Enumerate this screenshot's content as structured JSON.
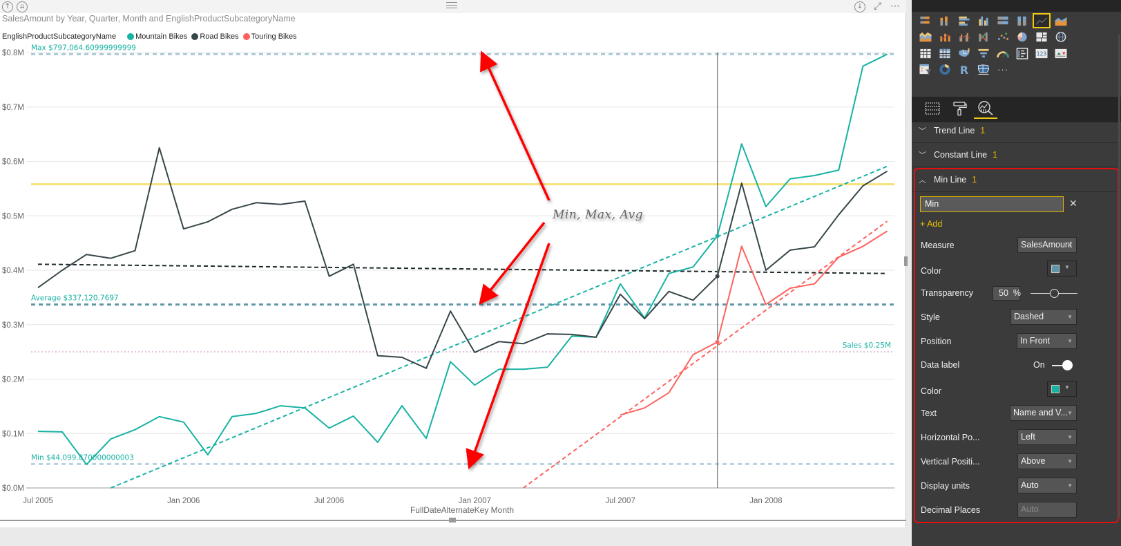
{
  "report": {
    "drill_up_icon": "arrow-up-circle-icon",
    "drill_down_icon": "double-arrow-down-circle-icon",
    "drill_mode_icon": "arrow-down-circle-icon",
    "focus_icon": "focus-mode-icon",
    "more_icon": "ellipsis-icon",
    "annotation_text": "Min, Max, Avg"
  },
  "chart_data": {
    "type": "line",
    "title": "SalesAmount by Year, Quarter, Month and EnglishProductSubcategoryName",
    "legend_title": "EnglishProductSubcategoryName",
    "legend_position": "top-left",
    "xlabel": "FullDateAlternateKey Month",
    "ylabel": "",
    "ylim": [
      0,
      0.8
    ],
    "y_unit": "$M",
    "yticks": [
      "$0.0M",
      "$0.1M",
      "$0.2M",
      "$0.3M",
      "$0.4M",
      "$0.5M",
      "$0.6M",
      "$0.7M",
      "$0.8M"
    ],
    "ytick_values": [
      0,
      0.1,
      0.2,
      0.3,
      0.4,
      0.5,
      0.6,
      0.7,
      0.8
    ],
    "xticks": [
      {
        "label": "Jul 2005",
        "month_index": 0
      },
      {
        "label": "Jan 2006",
        "month_index": 6
      },
      {
        "label": "Jul 2006",
        "month_index": 12
      },
      {
        "label": "Jan 2007",
        "month_index": 18
      },
      {
        "label": "Jul 2007",
        "month_index": 24
      },
      {
        "label": "Jan 2008",
        "month_index": 30
      }
    ],
    "x_months": 36,
    "grid": true,
    "series": [
      {
        "name": "Mountain Bikes",
        "color": "#16b2a3",
        "start_index": 0,
        "values": [
          0.104,
          0.103,
          0.043,
          0.09,
          0.107,
          0.131,
          0.121,
          0.061,
          0.131,
          0.137,
          0.151,
          0.147,
          0.11,
          0.132,
          0.084,
          0.151,
          0.091,
          0.232,
          0.189,
          0.218,
          0.218,
          0.222,
          0.279,
          0.277,
          0.375,
          0.312,
          0.394,
          0.406,
          0.463,
          0.632,
          0.517,
          0.568,
          0.574,
          0.584,
          0.775,
          0.797
        ],
        "trend": [
          0.0,
          0.591
        ],
        "trend_start_index": 3
      },
      {
        "name": "Road Bikes",
        "color": "#374649",
        "start_index": 0,
        "values": [
          0.368,
          0.4,
          0.429,
          0.422,
          0.436,
          0.625,
          0.476,
          0.489,
          0.512,
          0.524,
          0.521,
          0.527,
          0.389,
          0.411,
          0.243,
          0.24,
          0.22,
          0.325,
          0.249,
          0.269,
          0.265,
          0.283,
          0.282,
          0.277,
          0.356,
          0.311,
          0.361,
          0.345,
          0.389,
          0.56,
          0.4,
          0.437,
          0.443,
          0.502,
          0.555,
          0.582
        ],
        "trend": [
          0.411,
          0.394
        ],
        "trend_start_index": 0
      },
      {
        "name": "Touring Bikes",
        "color": "#fd625e",
        "start_index": 24,
        "values": [
          0.134,
          0.147,
          0.175,
          0.245,
          0.268,
          0.444,
          0.337,
          0.367,
          0.375,
          0.424,
          0.444,
          0.472
        ],
        "trend": [
          0.0,
          0.49
        ],
        "trend_start_index": 20
      }
    ],
    "reference_lines": [
      {
        "name": "Max",
        "value": 0.797,
        "label": "Max $797,064.60999999999",
        "color": "#a9c9d6",
        "style": "dashed",
        "label_position": "left-above"
      },
      {
        "name": "Constant",
        "value": 0.558,
        "label": "",
        "color": "#f5e27a",
        "style": "solid"
      },
      {
        "name": "Average",
        "value": 0.337,
        "label": "Average $337,120.7697",
        "color": "#5f96a9",
        "style": "dashed",
        "label_position": "left-above"
      },
      {
        "name": "Sales",
        "value": 0.25,
        "label": "Sales $0.25M",
        "color": "#e1bfdb",
        "style": "dotted",
        "label_position": "right-above"
      },
      {
        "name": "Min",
        "value": 0.044,
        "label": "Min $44,099.870000000003",
        "color": "#b7d3dd",
        "style": "dashed",
        "label_position": "left-above"
      }
    ],
    "hover_month_index": 28
  },
  "pane": {
    "gallery": [
      "stacked-bar-icon",
      "stacked-column-icon",
      "clustered-bar-icon",
      "clustered-column-icon",
      "100-stacked-bar-icon",
      "100-stacked-column-icon",
      "line-chart-icon",
      "area-chart-icon",
      "stacked-area-icon",
      "line-column-icon",
      "line-clustered-column-icon",
      "ribbon-chart-icon",
      "scatter-icon",
      "pie-icon",
      "treemap-icon",
      "globe-map-icon",
      "table-icon",
      "matrix-icon",
      "filled-map-icon",
      "funnel-icon",
      "gauge-icon",
      "multi-row-card-icon",
      "card-icon",
      "kpi-icon",
      "slicer-icon",
      "donut-icon",
      "r-visual-icon",
      "shape-map-icon",
      "more-visuals-icon"
    ],
    "gallery_selected": 6,
    "tabs": [
      {
        "name": "fields-tab",
        "icon": "fields-icon"
      },
      {
        "name": "format-tab",
        "icon": "paint-roller-icon"
      },
      {
        "name": "analytics-tab",
        "icon": "analytics-icon"
      }
    ],
    "active_tab": 2,
    "sections": [
      {
        "label": "Trend Line",
        "count": "1",
        "expanded": false
      },
      {
        "label": "Constant Line",
        "count": "1",
        "expanded": false
      },
      {
        "label": "Min Line",
        "count": "1",
        "expanded": true
      }
    ],
    "min_line": {
      "name_value": "Min",
      "add_label": "+ Add",
      "measure_label": "Measure",
      "measure_value": "SalesAmount",
      "color_label": "Color",
      "line_color": "#5f96a9",
      "transparency_label": "Transparency",
      "transparency_value": "50",
      "transparency_unit": "%",
      "transparency_pct": 50,
      "style_label": "Style",
      "style_value": "Dashed",
      "position_label": "Position",
      "position_value": "In Front",
      "data_label_label": "Data label",
      "data_label_value": "On",
      "label_color_label": "Color",
      "label_color": "#16b2a3",
      "text_label": "Text",
      "text_value": "Name and V...",
      "hpos_label": "Horizontal Po...",
      "hpos_value": "Left",
      "vpos_label": "Vertical Positi...",
      "vpos_value": "Above",
      "units_label": "Display units",
      "units_value": "Auto",
      "decimals_label": "Decimal Places",
      "decimals_placeholder": "Auto"
    }
  }
}
